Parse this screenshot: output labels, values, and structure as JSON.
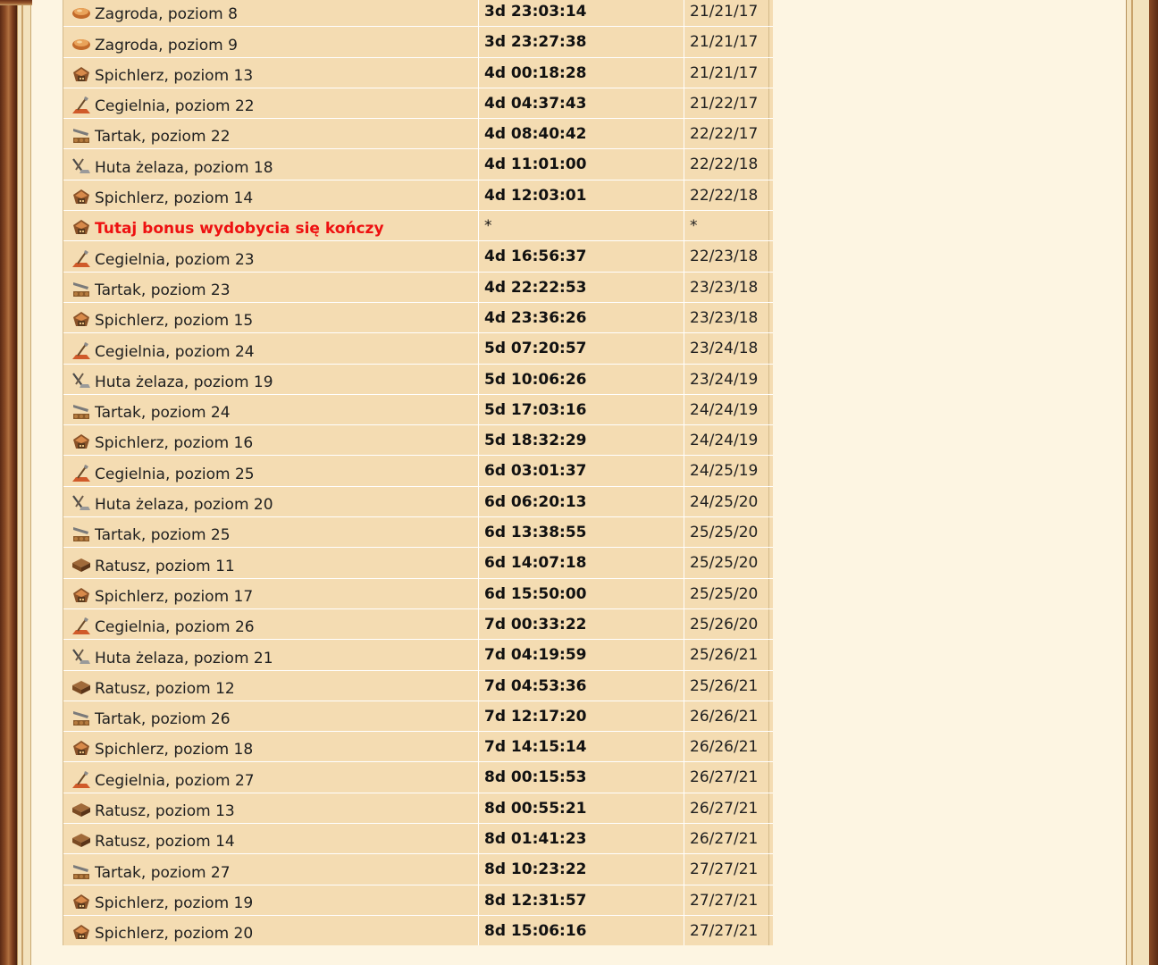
{
  "rows": [
    {
      "icon": "farm-icon",
      "name": "Zagroda, poziom 8",
      "time": "3d 23:03:14",
      "res": "21/21/17"
    },
    {
      "icon": "farm-icon",
      "name": "Zagroda, poziom 9",
      "time": "3d 23:27:38",
      "res": "21/21/17"
    },
    {
      "icon": "warehouse-icon",
      "name": "Spichlerz, poziom 13",
      "time": "4d 00:18:28",
      "res": "21/21/17"
    },
    {
      "icon": "clay-pit-icon",
      "name": "Cegielnia, poziom 22",
      "time": "4d 04:37:43",
      "res": "21/22/17"
    },
    {
      "icon": "sawmill-icon",
      "name": "Tartak, poziom 22",
      "time": "4d 08:40:42",
      "res": "22/22/17"
    },
    {
      "icon": "iron-mine-icon",
      "name": "Huta żelaza, poziom 18",
      "time": "4d 11:01:00",
      "res": "22/22/18"
    },
    {
      "icon": "warehouse-icon",
      "name": "Spichlerz, poziom 14",
      "time": "4d 12:03:01",
      "res": "22/22/18"
    },
    {
      "icon": "warehouse-icon",
      "name": "Tutaj bonus wydobycia się kończy",
      "time": "*",
      "res": "*",
      "bonus": true
    },
    {
      "icon": "clay-pit-icon",
      "name": "Cegielnia, poziom 23",
      "time": "4d 16:56:37",
      "res": "22/23/18"
    },
    {
      "icon": "sawmill-icon",
      "name": "Tartak, poziom 23",
      "time": "4d 22:22:53",
      "res": "23/23/18"
    },
    {
      "icon": "warehouse-icon",
      "name": "Spichlerz, poziom 15",
      "time": "4d 23:36:26",
      "res": "23/23/18"
    },
    {
      "icon": "clay-pit-icon",
      "name": "Cegielnia, poziom 24",
      "time": "5d 07:20:57",
      "res": "23/24/18"
    },
    {
      "icon": "iron-mine-icon",
      "name": "Huta żelaza, poziom 19",
      "time": "5d 10:06:26",
      "res": "23/24/19"
    },
    {
      "icon": "sawmill-icon",
      "name": "Tartak, poziom 24",
      "time": "5d 17:03:16",
      "res": "24/24/19"
    },
    {
      "icon": "warehouse-icon",
      "name": "Spichlerz, poziom 16",
      "time": "5d 18:32:29",
      "res": "24/24/19"
    },
    {
      "icon": "clay-pit-icon",
      "name": "Cegielnia, poziom 25",
      "time": "6d 03:01:37",
      "res": "24/25/19"
    },
    {
      "icon": "iron-mine-icon",
      "name": "Huta żelaza, poziom 20",
      "time": "6d 06:20:13",
      "res": "24/25/20"
    },
    {
      "icon": "sawmill-icon",
      "name": "Tartak, poziom 25",
      "time": "6d 13:38:55",
      "res": "25/25/20"
    },
    {
      "icon": "town-hall-icon",
      "name": "Ratusz, poziom 11",
      "time": "6d 14:07:18",
      "res": "25/25/20"
    },
    {
      "icon": "warehouse-icon",
      "name": "Spichlerz, poziom 17",
      "time": "6d 15:50:00",
      "res": "25/25/20"
    },
    {
      "icon": "clay-pit-icon",
      "name": "Cegielnia, poziom 26",
      "time": "7d 00:33:22",
      "res": "25/26/20"
    },
    {
      "icon": "iron-mine-icon",
      "name": "Huta żelaza, poziom 21",
      "time": "7d 04:19:59",
      "res": "25/26/21"
    },
    {
      "icon": "town-hall-icon",
      "name": "Ratusz, poziom 12",
      "time": "7d 04:53:36",
      "res": "25/26/21"
    },
    {
      "icon": "sawmill-icon",
      "name": "Tartak, poziom 26",
      "time": "7d 12:17:20",
      "res": "26/26/21"
    },
    {
      "icon": "warehouse-icon",
      "name": "Spichlerz, poziom 18",
      "time": "7d 14:15:14",
      "res": "26/26/21"
    },
    {
      "icon": "clay-pit-icon",
      "name": "Cegielnia, poziom 27",
      "time": "8d 00:15:53",
      "res": "26/27/21"
    },
    {
      "icon": "town-hall-icon",
      "name": "Ratusz, poziom 13",
      "time": "8d 00:55:21",
      "res": "26/27/21"
    },
    {
      "icon": "town-hall-icon",
      "name": "Ratusz, poziom 14",
      "time": "8d 01:41:23",
      "res": "26/27/21"
    },
    {
      "icon": "sawmill-icon",
      "name": "Tartak, poziom 27",
      "time": "8d 10:23:22",
      "res": "27/27/21"
    },
    {
      "icon": "warehouse-icon",
      "name": "Spichlerz, poziom 19",
      "time": "8d 12:31:57",
      "res": "27/27/21"
    },
    {
      "icon": "warehouse-icon",
      "name": "Spichlerz, poziom 20",
      "time": "8d 15:06:16",
      "res": "27/27/21"
    }
  ]
}
